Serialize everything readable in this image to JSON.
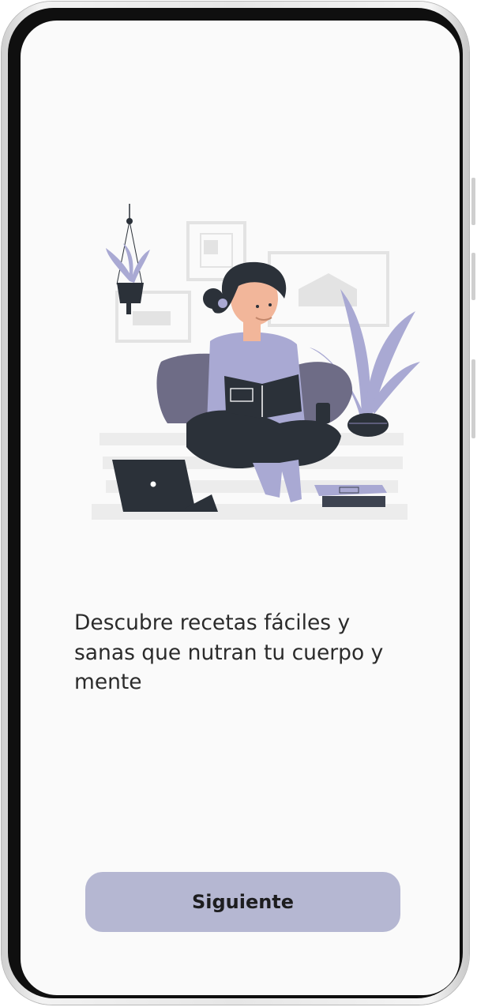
{
  "onboarding": {
    "headline": "Descubre recetas fáciles y sanas que nutran tu cuerpo y mente",
    "next_label": "Siguiente",
    "illustration": "woman-reading-at-home-illustration"
  },
  "colors": {
    "accent": "#b5b7d2",
    "screen_bg": "#fafafa",
    "text": "#2b2b2b",
    "dark": "#2b3139",
    "lavender": "#a9a9d3"
  }
}
